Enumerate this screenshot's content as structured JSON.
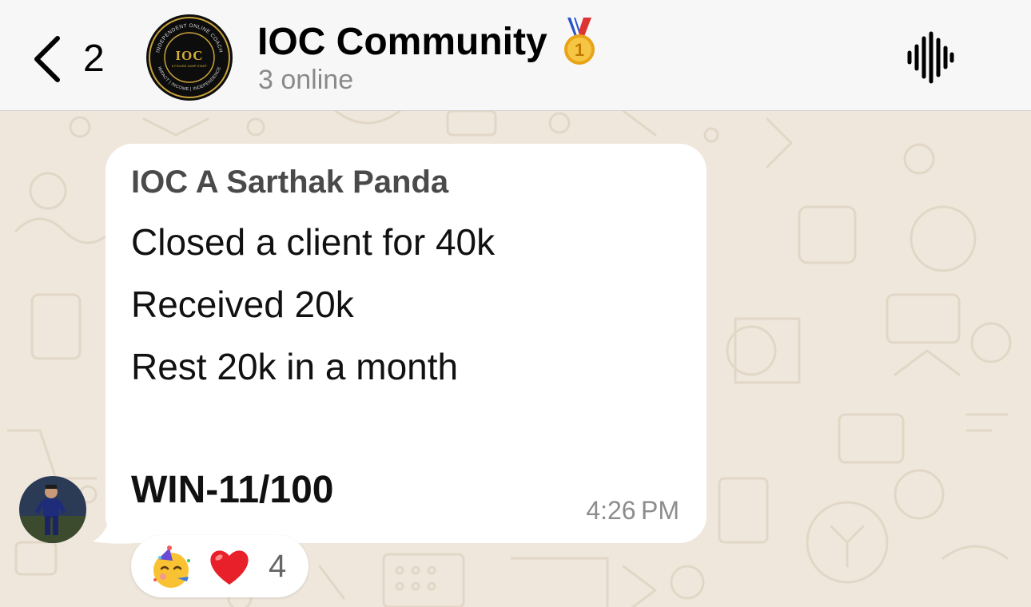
{
  "header": {
    "back_count": "2",
    "title": "IOC Community",
    "status": "3 online",
    "avatar_logo": {
      "main": "IOC",
      "ring_top": "INDEPENDENT ONLINE COACH",
      "ring_bottom": "IMPACT | INCOME | INDEPENDENCE",
      "tagline": "6 FIGURE JUMP START"
    },
    "title_icon": "first-place-medal-icon",
    "action_icon": "voice-waveform-icon"
  },
  "message": {
    "sender": "IOC A Sarthak Panda",
    "lines": [
      "Closed a client for 40k",
      "Received 20k",
      "Rest 20k in a month"
    ],
    "win": "WIN-11/100",
    "time": "4:26 PM"
  },
  "reactions": {
    "emojis": [
      "partying-face-icon",
      "red-heart-icon"
    ],
    "count": "4"
  },
  "colors": {
    "header_bg": "#f7f7f7",
    "chat_bg": "#efe7dc",
    "bubble_bg": "#ffffff",
    "sender_name": "#4a4a4a",
    "meta_text": "#8c8c8c"
  }
}
